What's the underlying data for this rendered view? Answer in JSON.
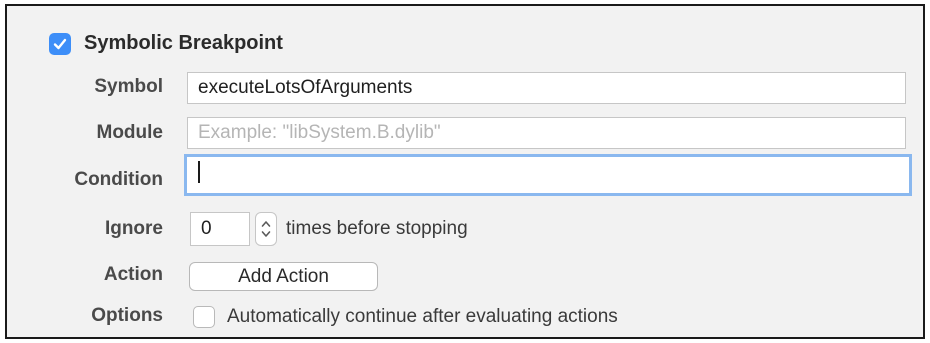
{
  "section": {
    "title": "Symbolic Breakpoint",
    "enabled": true
  },
  "fields": {
    "symbol": {
      "label": "Symbol",
      "value": "executeLotsOfArguments"
    },
    "module": {
      "label": "Module",
      "value": "",
      "placeholder": "Example: \"libSystem.B.dylib\""
    },
    "condition": {
      "label": "Condition",
      "value": ""
    },
    "ignore": {
      "label": "Ignore",
      "value": "0",
      "suffix": "times before stopping"
    },
    "action": {
      "label": "Action",
      "button_label": "Add Action"
    },
    "options": {
      "label": "Options",
      "checkbox_label": "Automatically continue after evaluating actions",
      "checked": false
    }
  },
  "icons": {
    "enabled_checkbox": "checkmark-icon",
    "stepper": "up-down-stepper-icon"
  },
  "colors": {
    "accent": "#3d8ef8",
    "focus_ring": "#8ab8ef",
    "panel_background": "#f2f2f2"
  }
}
